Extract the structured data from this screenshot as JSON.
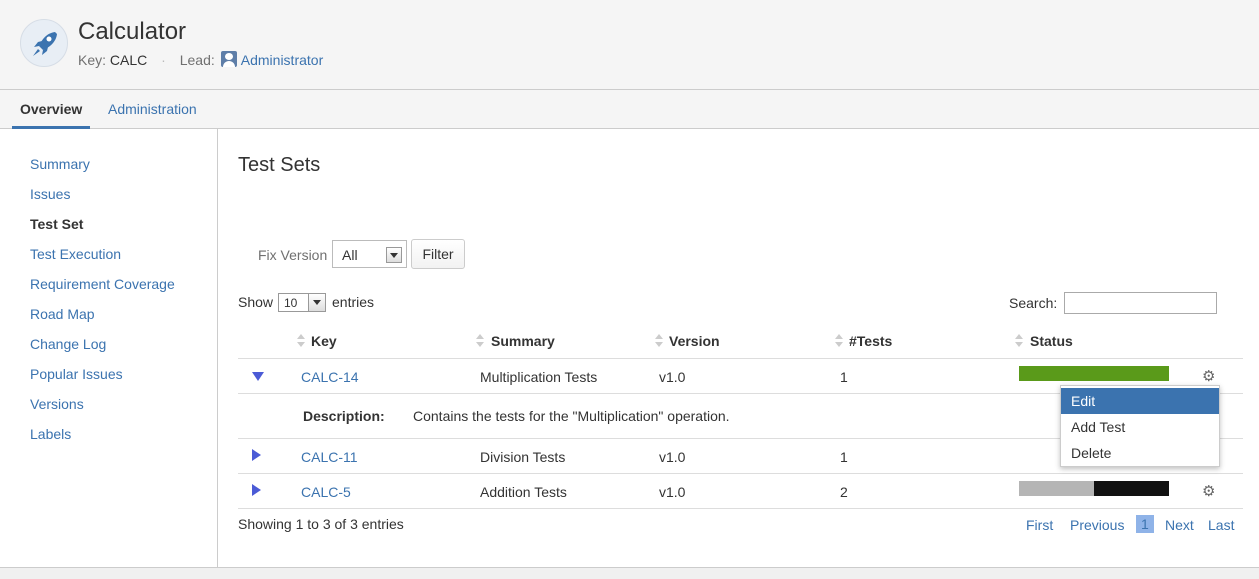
{
  "project": {
    "name": "Calculator",
    "key_label": "Key:",
    "key": "CALC",
    "lead_label": "Lead:",
    "lead": "Administrator"
  },
  "tabs": [
    {
      "label": "Overview",
      "active": true
    },
    {
      "label": "Administration",
      "active": false
    }
  ],
  "sidebar": {
    "items": [
      {
        "label": "Summary"
      },
      {
        "label": "Issues"
      },
      {
        "label": "Test Set",
        "active": true
      },
      {
        "label": "Test Execution"
      },
      {
        "label": "Requirement Coverage"
      },
      {
        "label": "Road Map"
      },
      {
        "label": "Change Log"
      },
      {
        "label": "Popular Issues"
      },
      {
        "label": "Versions"
      },
      {
        "label": "Labels"
      }
    ]
  },
  "main": {
    "title": "Test Sets",
    "filter": {
      "fix_version_label": "Fix Version",
      "fix_version_value": "All",
      "filter_button": "Filter"
    },
    "table_controls": {
      "show_label": "Show",
      "page_size": "10",
      "entries_label": "entries",
      "search_label": "Search:",
      "search_value": ""
    },
    "table": {
      "headers": [
        "Key",
        "Summary",
        "Version",
        "#Tests",
        "Status"
      ],
      "rows": [
        {
          "key": "CALC-14",
          "summary": "Multiplication Tests",
          "version": "v1.0",
          "tests": "1",
          "expanded": true,
          "status": [
            {
              "color": "#5a9a1a",
              "fraction": 1.0
            }
          ]
        },
        {
          "key": "CALC-11",
          "summary": "Division Tests",
          "version": "v1.0",
          "tests": "1",
          "expanded": false,
          "status": []
        },
        {
          "key": "CALC-5",
          "summary": "Addition Tests",
          "version": "v1.0",
          "tests": "2",
          "expanded": false,
          "status": [
            {
              "color": "#b5b5b5",
              "fraction": 0.5
            },
            {
              "color": "#111111",
              "fraction": 0.5
            }
          ]
        }
      ],
      "description": {
        "label": "Description:",
        "text": "Contains the tests for the \"Multiplication\" operation."
      }
    },
    "footer": {
      "showing": "Showing 1 to 3 of 3 entries",
      "first": "First",
      "previous": "Previous",
      "current_page": "1",
      "next": "Next",
      "last": "Last"
    },
    "action_menu": {
      "items": [
        "Edit",
        "Add Test",
        "Delete"
      ],
      "highlighted": "Edit"
    }
  },
  "icons": {
    "project": "rocket-icon",
    "lead": "user-icon",
    "expand": "triangle-icon",
    "actions": "gear-icon"
  }
}
